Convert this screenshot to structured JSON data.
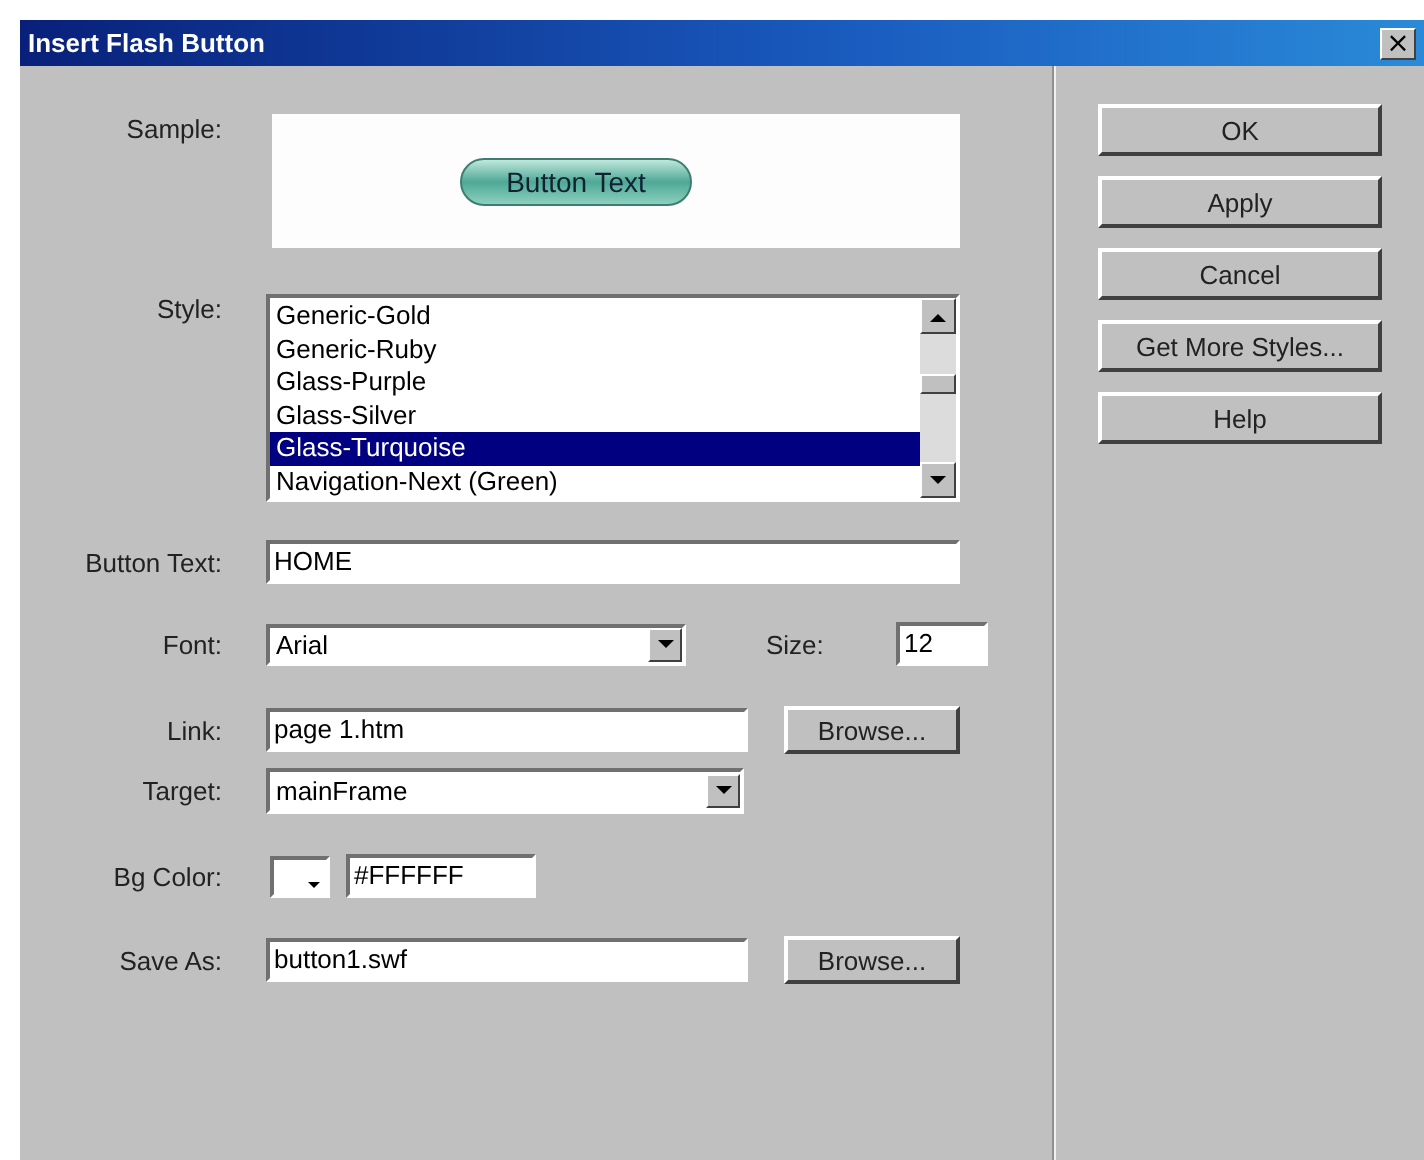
{
  "window": {
    "title": "Insert Flash Button",
    "close": "×"
  },
  "sample": {
    "label": "Sample:",
    "button_text": "Button Text"
  },
  "style": {
    "label": "Style:",
    "items": [
      {
        "label": "Generic-Gold",
        "selected": false
      },
      {
        "label": "Generic-Ruby",
        "selected": false
      },
      {
        "label": "Glass-Purple",
        "selected": false
      },
      {
        "label": "Glass-Silver",
        "selected": false
      },
      {
        "label": "Glass-Turquoise",
        "selected": true
      },
      {
        "label": "Navigation-Next (Green)",
        "selected": false
      }
    ]
  },
  "button_text": {
    "label": "Button Text:",
    "value": "HOME"
  },
  "font": {
    "label": "Font:",
    "value": "Arial"
  },
  "size": {
    "label": "Size:",
    "value": "12"
  },
  "link": {
    "label": "Link:",
    "value": "page 1.htm",
    "button": "Browse..."
  },
  "target": {
    "label": "Target:",
    "value": "mainFrame"
  },
  "bg_color": {
    "label": "Bg Color:",
    "value": "#FFFFFF"
  },
  "save_as": {
    "label": "Save As:",
    "value": "button1.swf",
    "button": "Browse..."
  },
  "buttons": [
    "OK",
    "Apply",
    "Cancel",
    "Get More Styles...",
    "Help"
  ]
}
